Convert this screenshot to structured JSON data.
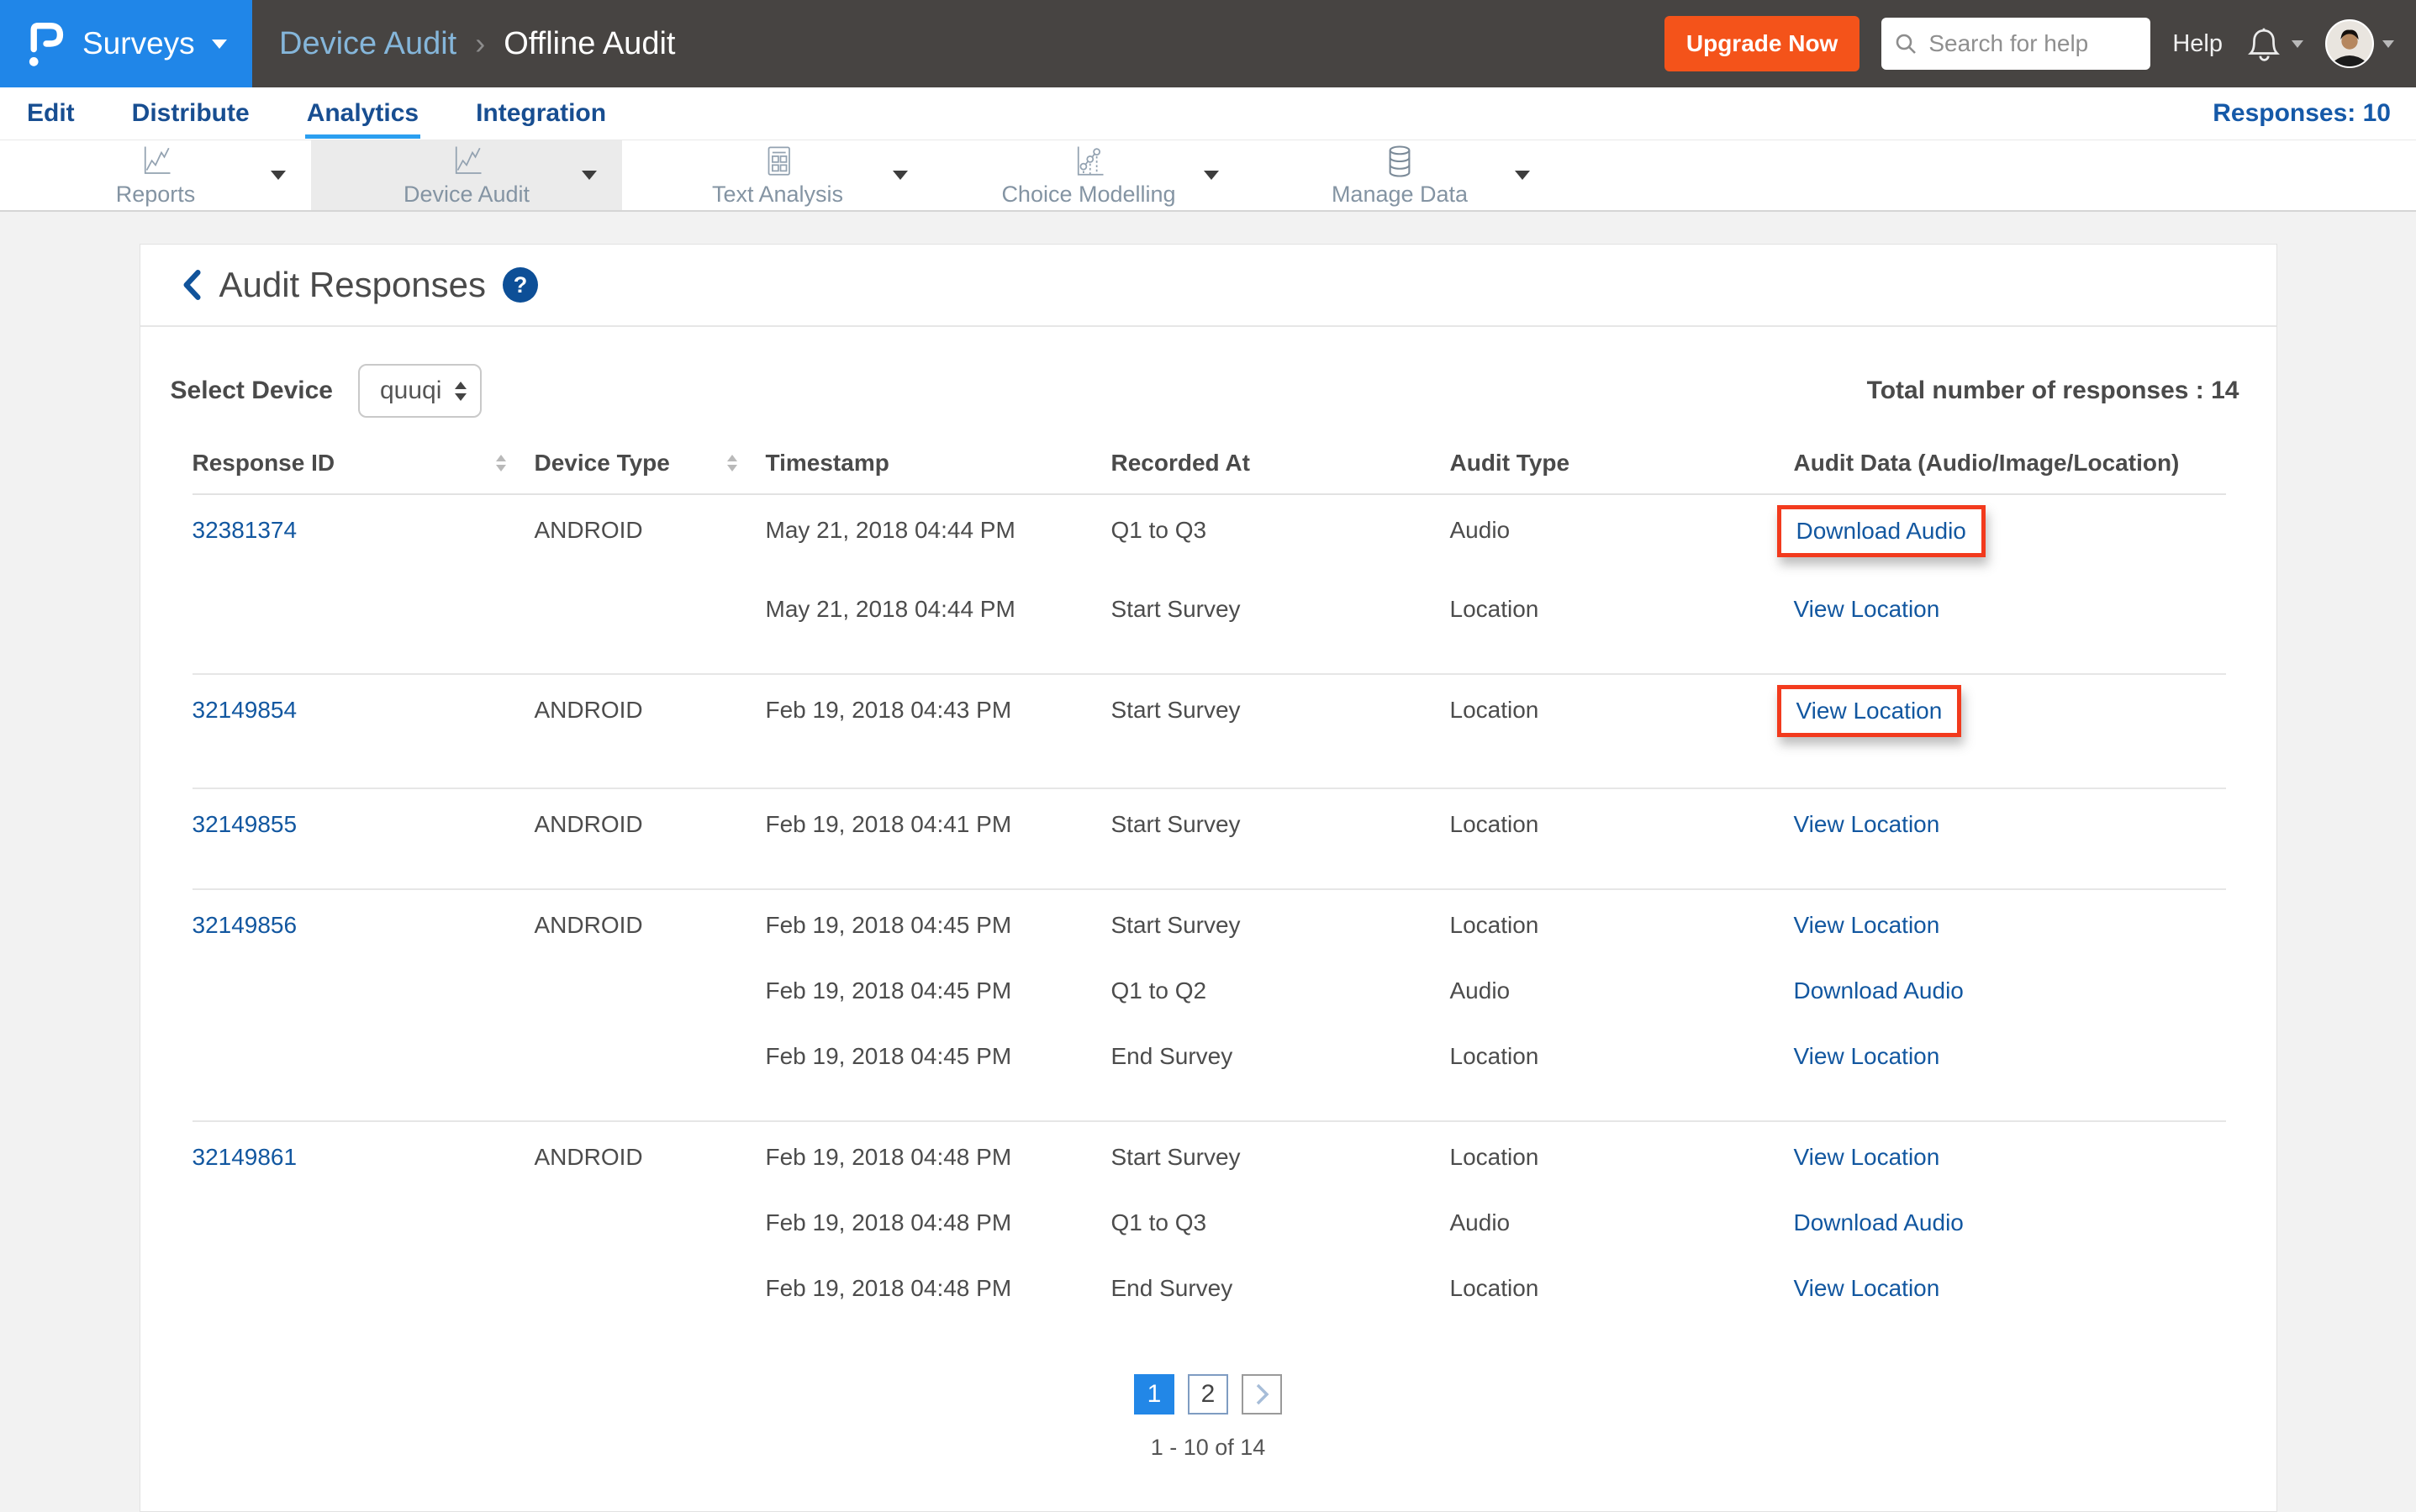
{
  "header": {
    "brand_label": "Surveys",
    "breadcrumb": {
      "section": "Device Audit",
      "page": "Offline Audit"
    },
    "upgrade_label": "Upgrade Now",
    "search_placeholder": "Search for help",
    "help_label": "Help",
    "icons": [
      "questionpro-logo-icon",
      "caret-down-icon",
      "search-icon",
      "bell-icon",
      "avatar"
    ]
  },
  "tabs": {
    "items": [
      {
        "label": "Edit",
        "active": false
      },
      {
        "label": "Distribute",
        "active": false
      },
      {
        "label": "Analytics",
        "active": true
      },
      {
        "label": "Integration",
        "active": false
      }
    ],
    "responses_label": "Responses: 10"
  },
  "toolbar": {
    "items": [
      {
        "label": "Reports",
        "icon": "line-chart-icon",
        "active": false
      },
      {
        "label": "Device Audit",
        "icon": "line-chart-icon",
        "active": true
      },
      {
        "label": "Text Analysis",
        "icon": "document-grid-icon",
        "active": false
      },
      {
        "label": "Choice Modelling",
        "icon": "bubble-trend-icon",
        "active": false
      },
      {
        "label": "Manage Data",
        "icon": "database-icon",
        "active": false
      }
    ]
  },
  "page": {
    "title": "Audit Responses",
    "select_device_label": "Select Device",
    "device_value": "quuqi",
    "total_responses_label": "Total number of responses : 14"
  },
  "table": {
    "columns": [
      "Response ID",
      "Device Type",
      "Timestamp",
      "Recorded At",
      "Audit Type",
      "Audit Data (Audio/Image/Location)"
    ],
    "groups": [
      {
        "response_id": "32381374",
        "device_type": "ANDROID",
        "entries": [
          {
            "timestamp": "May 21, 2018 04:44 PM",
            "recorded_at": "Q1 to Q3",
            "audit_type": "Audio",
            "action": "Download Audio",
            "highlighted": true
          },
          {
            "timestamp": "May 21, 2018 04:44 PM",
            "recorded_at": "Start Survey",
            "audit_type": "Location",
            "action": "View Location",
            "highlighted": false
          }
        ]
      },
      {
        "response_id": "32149854",
        "device_type": "ANDROID",
        "entries": [
          {
            "timestamp": "Feb 19, 2018 04:43 PM",
            "recorded_at": "Start Survey",
            "audit_type": "Location",
            "action": "View Location",
            "highlighted": true
          }
        ]
      },
      {
        "response_id": "32149855",
        "device_type": "ANDROID",
        "entries": [
          {
            "timestamp": "Feb 19, 2018 04:41 PM",
            "recorded_at": "Start Survey",
            "audit_type": "Location",
            "action": "View Location",
            "highlighted": false
          }
        ]
      },
      {
        "response_id": "32149856",
        "device_type": "ANDROID",
        "entries": [
          {
            "timestamp": "Feb 19, 2018 04:45 PM",
            "recorded_at": "Start Survey",
            "audit_type": "Location",
            "action": "View Location",
            "highlighted": false
          },
          {
            "timestamp": "Feb 19, 2018 04:45 PM",
            "recorded_at": "Q1 to Q2",
            "audit_type": "Audio",
            "action": "Download Audio",
            "highlighted": false
          },
          {
            "timestamp": "Feb 19, 2018 04:45 PM",
            "recorded_at": "End Survey",
            "audit_type": "Location",
            "action": "View Location",
            "highlighted": false
          }
        ]
      },
      {
        "response_id": "32149861",
        "device_type": "ANDROID",
        "entries": [
          {
            "timestamp": "Feb 19, 2018 04:48 PM",
            "recorded_at": "Start Survey",
            "audit_type": "Location",
            "action": "View Location",
            "highlighted": false
          },
          {
            "timestamp": "Feb 19, 2018 04:48 PM",
            "recorded_at": "Q1 to Q3",
            "audit_type": "Audio",
            "action": "Download Audio",
            "highlighted": false
          },
          {
            "timestamp": "Feb 19, 2018 04:48 PM",
            "recorded_at": "End Survey",
            "audit_type": "Location",
            "action": "View Location",
            "highlighted": false
          }
        ]
      }
    ]
  },
  "pagination": {
    "pages": [
      "1",
      "2"
    ],
    "active_page": "1",
    "range_label": "1 - 10 of 14"
  },
  "colors": {
    "brand_blue": "#2086e8",
    "topbar_dark": "#474442",
    "upgrade_orange": "#f4531a",
    "link_blue": "#1257a0",
    "tab_navy": "#184e91",
    "active_tab_underline": "#2b9ff0",
    "highlight_red": "#f23a1d",
    "help_badge_blue": "#0d4f97"
  }
}
